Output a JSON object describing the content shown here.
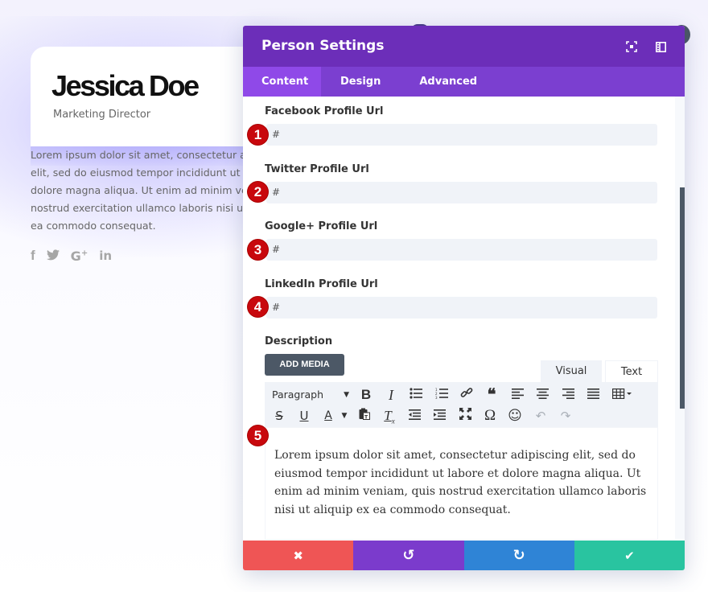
{
  "person": {
    "name": "Jessica Doe",
    "position": "Marketing Director",
    "description_lines": [
      "Lorem ipsum dolor sit amet, consectetur ad",
      "elit, sed do eiusmod tempor incididunt ut lal",
      "dolore magna aliqua. Ut enim ad minim ven",
      "nostrud exercitation ullamco laboris nisi ut a",
      "ea commodo consequat."
    ],
    "social_icons": [
      "facebook-icon",
      "twitter-icon",
      "google-plus-icon",
      "linkedin-icon"
    ],
    "social_glyphs": [
      "f",
      "🐦",
      "G+",
      "in"
    ]
  },
  "modal": {
    "title": "Person Settings",
    "header_icons": [
      "fullscreen-icon",
      "sidebar-toggle-icon"
    ],
    "tabs": [
      {
        "label": "Content",
        "active": true
      },
      {
        "label": "Design",
        "active": false
      },
      {
        "label": "Advanced",
        "active": false
      }
    ],
    "fields": [
      {
        "label": "Facebook Profile Url",
        "value": "#",
        "badge": "1"
      },
      {
        "label": "Twitter Profile Url",
        "value": "#",
        "badge": "2"
      },
      {
        "label": "Google+ Profile Url",
        "value": "#",
        "badge": "3"
      },
      {
        "label": "LinkedIn Profile Url",
        "value": "#",
        "badge": "4"
      }
    ],
    "description": {
      "label": "Description",
      "add_media_label": "ADD MEDIA",
      "editor_tabs": {
        "visual": "Visual",
        "text": "Text",
        "active": "Visual"
      },
      "format_select": "Paragraph",
      "badge": "5",
      "content": "Lorem ipsum dolor sit amet, consectetur adipiscing elit, sed do eiusmod tempor incididunt ut labore et dolore magna aliqua. Ut enim ad minim veniam, quis nostrud exercitation ullamco laboris nisi ut aliquip ex ea commodo consequat.",
      "toolbar_row1": [
        "bold",
        "italic",
        "bulleted-list",
        "numbered-list",
        "link",
        "blockquote",
        "align-left",
        "align-center",
        "align-right",
        "align-justify",
        "table"
      ],
      "toolbar_row2": [
        "strikethrough",
        "underline",
        "text-color",
        "paste-as-text",
        "clear-formatting",
        "outdent",
        "indent",
        "fullscreen",
        "special-character",
        "emoji",
        "undo",
        "redo"
      ]
    },
    "footer": {
      "buttons": [
        {
          "name": "discard",
          "glyph": "✖",
          "color": "#ef5555"
        },
        {
          "name": "undo",
          "glyph": "↺",
          "color": "#7b3bcc"
        },
        {
          "name": "redo",
          "glyph": "↻",
          "color": "#2f84d6"
        },
        {
          "name": "save",
          "glyph": "✔",
          "color": "#29c4a0"
        }
      ]
    }
  },
  "colors": {
    "header": "#6c2eb9",
    "tabs": "#7b3fd0",
    "active_tab": "#8f49e8",
    "badge": "#c8080d",
    "input_bg": "#f0f3f8",
    "dark": "#4c5866"
  }
}
